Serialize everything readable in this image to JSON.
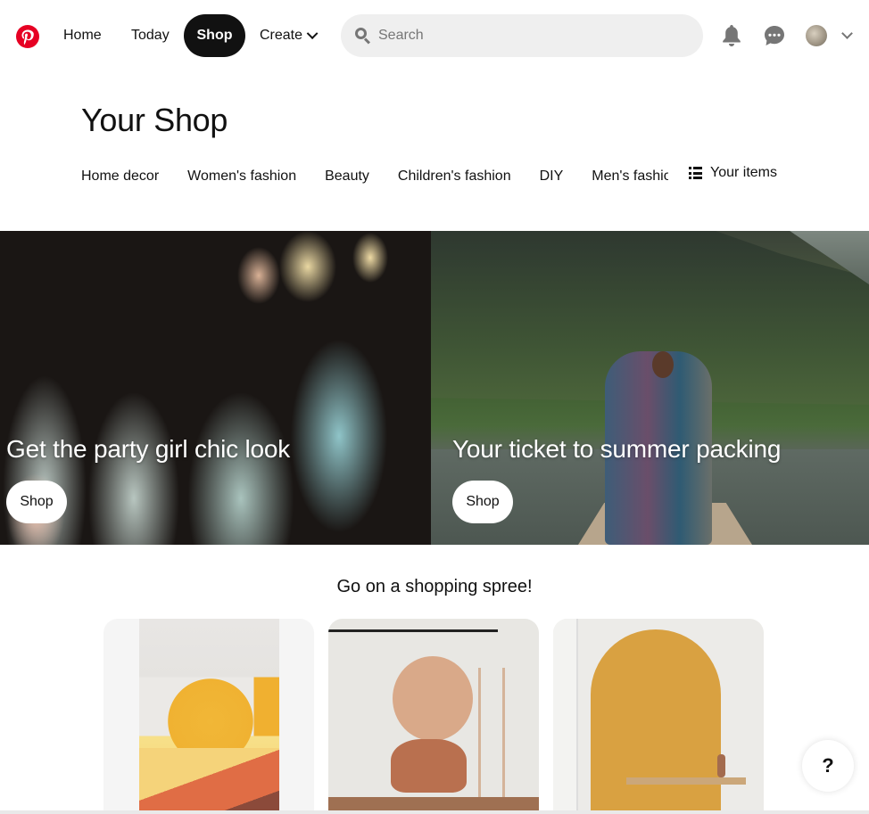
{
  "header": {
    "logo": "pinterest-logo",
    "nav": [
      {
        "label": "Home",
        "active": false
      },
      {
        "label": "Today",
        "active": false
      },
      {
        "label": "Shop",
        "active": true
      },
      {
        "label": "Create",
        "active": false,
        "has_dropdown": true
      }
    ],
    "search": {
      "placeholder": "Search",
      "value": ""
    },
    "icons": [
      "bell-icon",
      "message-icon",
      "avatar",
      "chevron-down-icon"
    ],
    "brand_color": "#e60023"
  },
  "page": {
    "title": "Your Shop",
    "categories": [
      "Home decor",
      "Women's fashion",
      "Beauty",
      "Children's fashion",
      "DIY",
      "Men's fashion"
    ],
    "your_items_label": "Your items"
  },
  "hero": [
    {
      "title": "Get the party girl chic look",
      "button": "Shop"
    },
    {
      "title": "Your ticket to summer packing",
      "button": "Shop"
    }
  ],
  "spree": {
    "title": "Go on a shopping spree!",
    "cards": [
      "bedroom-mural-card",
      "botanical-mural-card",
      "arch-mural-card"
    ]
  },
  "help": {
    "label": "?"
  }
}
